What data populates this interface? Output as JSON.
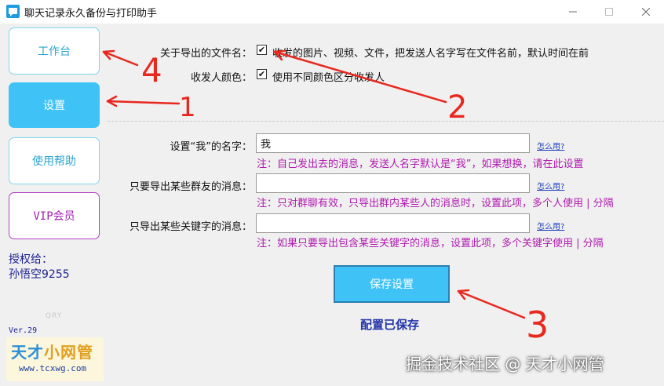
{
  "window": {
    "title": "聊天记录永久备份与打印助手",
    "controls": {
      "minimize": "—",
      "maximize": "☐",
      "close": "✕"
    }
  },
  "sidebar": {
    "items": [
      {
        "label": "工作台"
      },
      {
        "label": "设置"
      },
      {
        "label": "使用帮助"
      },
      {
        "label": "VIP会员"
      }
    ],
    "active_index": 1,
    "auth_label": "授权给：",
    "auth_user": "孙悟空9255",
    "faint_text": "QRY",
    "version": "Ver.29"
  },
  "watermark_left": {
    "title_part1": "天才",
    "title_part2": "小网管",
    "url": "www.tcxwg.com"
  },
  "settings": {
    "export_filename": {
      "label": "关于导出的文件名：",
      "checked": true,
      "text": "收发的图片、视频、文件，把发送人名字写在文件名前，默认时间在前"
    },
    "sender_color": {
      "label": "收发人颜色：",
      "checked": true,
      "text": "使用不同颜色区分收发人"
    },
    "my_name": {
      "label": "设置“我”的名字：",
      "value": "我",
      "help": "怎么用?",
      "note": "注：自己发出去的消息，发送人名字默认是“我”，如果想换，请在此设置"
    },
    "group_members": {
      "label": "只要导出某些群友的消息：",
      "value": "",
      "help": "怎么用?",
      "note": "注：只对群聊有效，只导出群内某些人的消息时，设置此项，多个人使用 | 分隔"
    },
    "keywords": {
      "label": "只导出某些关键字的消息：",
      "value": "",
      "help": "怎么用?",
      "note": "注：如果只要导出包含某些关键字的消息，设置此项，多个关键字使用 | 分隔"
    },
    "save_button": "保存设置",
    "saved_status": "配置已保存"
  },
  "watermark_bottom": "掘金技术社区 @ 天才小网管",
  "annotations": {
    "numbers": [
      "1",
      "2",
      "3",
      "4"
    ],
    "color": "#e8281e"
  },
  "colors": {
    "accent": "#3fc3f7",
    "note": "#b01ab0",
    "link": "#1b3fbf",
    "auth": "#1a1f8f"
  }
}
